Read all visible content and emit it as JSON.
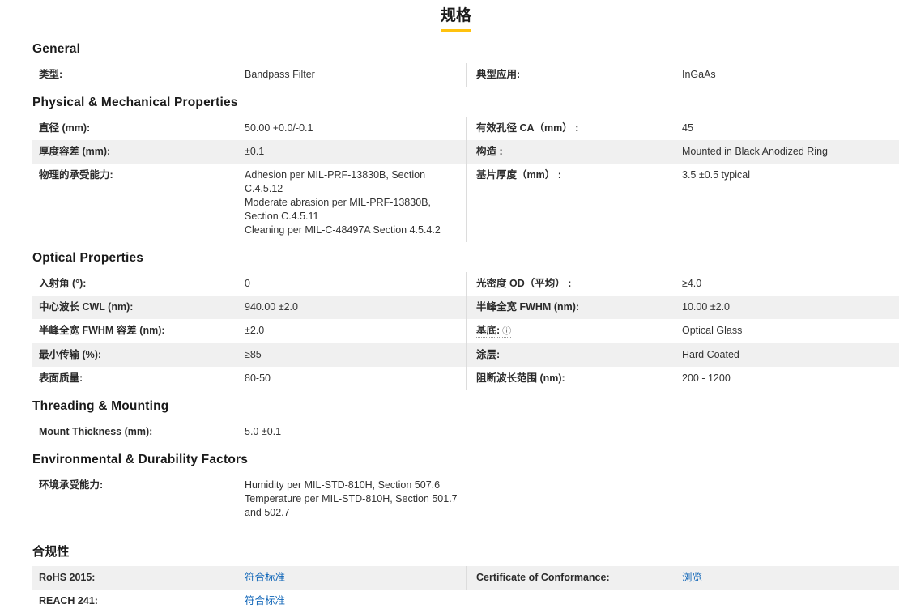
{
  "page": {
    "title": "规格"
  },
  "colors": {
    "accent_yellow": "#FFC20E",
    "link_blue": "#1066B8",
    "stripe_gray": "#F0F0F0",
    "divider_gray": "#DCDCDC"
  },
  "icons": {
    "info": "ⓘ"
  },
  "sections": [
    {
      "heading": "General",
      "rows": [
        {
          "left": {
            "label": "类型:",
            "value": "Bandpass Filter"
          },
          "right": {
            "label": "典型应用:",
            "value": "InGaAs"
          }
        }
      ]
    },
    {
      "heading": "Physical & Mechanical Properties",
      "rows": [
        {
          "left": {
            "label": "直径 (mm):",
            "value": "50.00 +0.0/-0.1"
          },
          "right": {
            "label": "有效孔径 CA（mm） :",
            "value": "45"
          }
        },
        {
          "left": {
            "label": "厚度容差 (mm):",
            "value": "±0.1"
          },
          "right": {
            "label": "构造 :",
            "value": "Mounted in Black Anodized Ring"
          }
        },
        {
          "left": {
            "label": "物理的承受能力:",
            "value": "Adhesion per MIL-PRF-13830B, Section C.4.5.12\nModerate abrasion per MIL-PRF-13830B, Section C.4.5.11\nCleaning per MIL-C-48497A Section 4.5.4.2"
          },
          "right": {
            "label": "基片厚度（mm） :",
            "value": "3.5 ±0.5 typical"
          }
        }
      ]
    },
    {
      "heading": "Optical Properties",
      "rows": [
        {
          "left": {
            "label": "入射角 (°):",
            "value": "0"
          },
          "right": {
            "label": "光密度 OD（平均） :",
            "value": "≥4.0"
          }
        },
        {
          "left": {
            "label": "中心波长 CWL (nm):",
            "value": "940.00 ±2.0"
          },
          "right": {
            "label": "半峰全宽 FWHM (nm):",
            "value": "10.00 ±2.0"
          }
        },
        {
          "left": {
            "label": "半峰全宽 FWHM 容差 (nm):",
            "value": "±2.0"
          },
          "right": {
            "label": "基底:",
            "value": "Optical Glass"
          }
        },
        {
          "left": {
            "label": "最小传输 (%):",
            "value": "≥85"
          },
          "right": {
            "label": "涂层:",
            "value": "Hard Coated"
          }
        },
        {
          "left": {
            "label": "表面质量:",
            "value": "80-50"
          },
          "right": {
            "label": "阻断波长范围 (nm):",
            "value": "200 - 1200"
          }
        }
      ]
    },
    {
      "heading": "Threading & Mounting",
      "rows": [
        {
          "left": {
            "label": "Mount Thickness (mm):",
            "value": "5.0 ±0.1"
          }
        }
      ]
    },
    {
      "heading": "Environmental & Durability Factors",
      "rows": [
        {
          "left": {
            "label": "环境承受能力:",
            "value": "Humidity per MIL-STD-810H, Section 507.6\nTemperature per MIL-STD-810H, Section 501.7 and 502.7"
          }
        }
      ]
    },
    {
      "heading": "合规性",
      "rows": [
        {
          "left": {
            "label": "RoHS 2015:",
            "value": "符合标准"
          },
          "right": {
            "label": "Certificate of Conformance:",
            "value": "浏览"
          }
        },
        {
          "left": {
            "label": "REACH 241:",
            "value": "符合标准"
          }
        }
      ]
    }
  ]
}
